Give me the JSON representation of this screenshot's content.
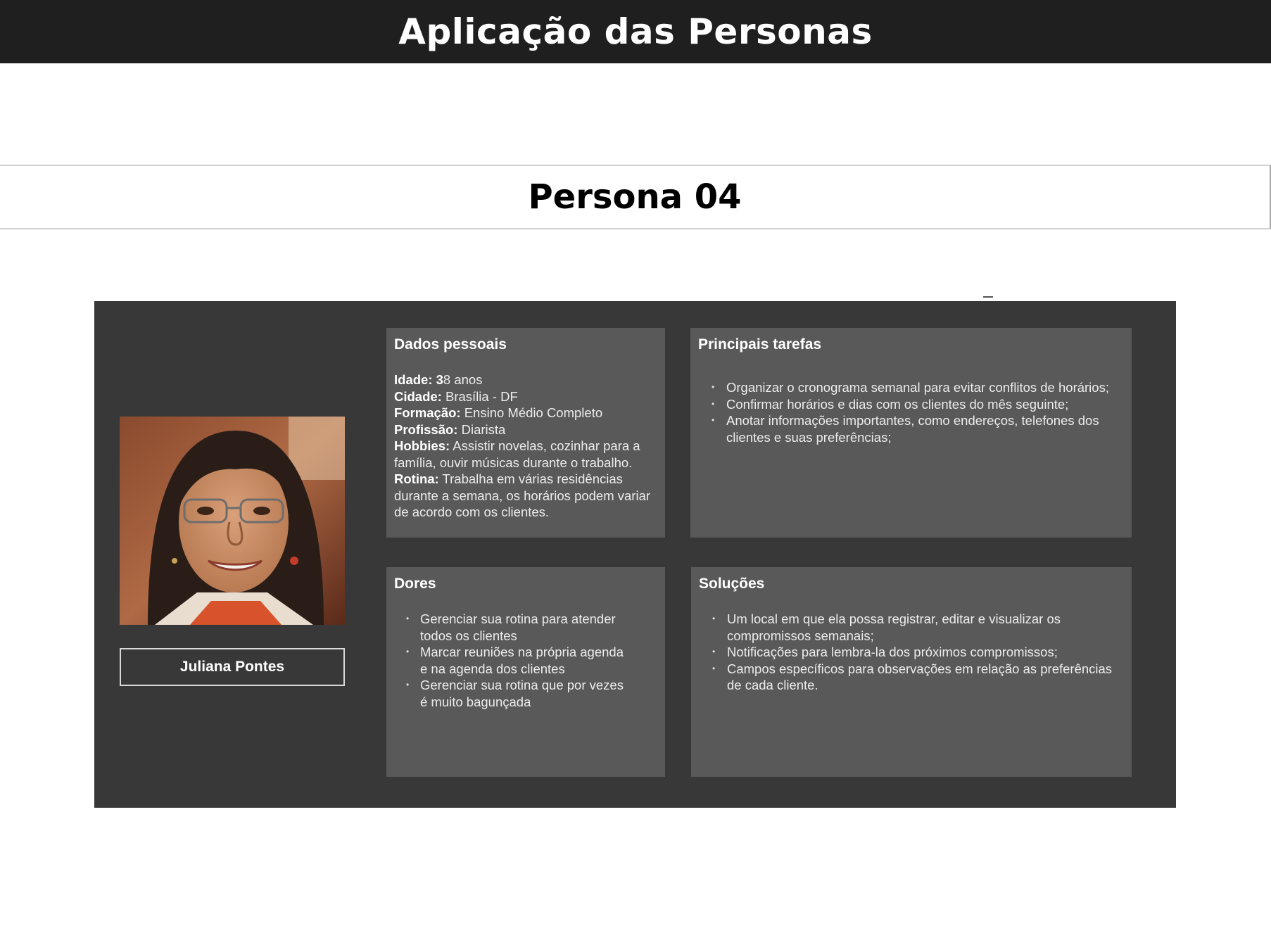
{
  "header": {
    "title": "Aplicação das Personas"
  },
  "persona": {
    "heading": "Persona 04",
    "name": "Juliana Pontes",
    "dados": {
      "title": "Dados pessoais",
      "fields": [
        {
          "label": "Idade:",
          "prefix": " 3",
          "value": "8 anos"
        },
        {
          "label": "Cidade:",
          "value": " Brasília - DF"
        },
        {
          "label": "Formação:",
          "value": " Ensino Médio Completo"
        },
        {
          "label": "Profissão:",
          "value": " Diarista"
        },
        {
          "label": "Hobbies:",
          "value": " Assistir novelas, cozinhar para a família, ouvir músicas durante o trabalho."
        },
        {
          "label": "Rotina:",
          "value": " Trabalha em várias residências durante a semana, os horários podem variar de acordo com os clientes."
        }
      ]
    },
    "tarefas": {
      "title": "Principais tarefas",
      "items": [
        "Organizar o cronograma semanal para evitar conflitos de horários;",
        "Confirmar horários e dias com os clientes do mês seguinte;",
        "Anotar informações importantes, como endereços, telefones dos clientes e suas preferências;"
      ]
    },
    "dores": {
      "title": "Dores",
      "items": [
        "Gerenciar sua rotina para atender todos os clientes",
        "Marcar reuniões na própria agenda e na agenda dos clientes",
        "Gerenciar sua rotina que por vezes é muito bagunçada"
      ]
    },
    "solucoes": {
      "title": "Soluções",
      "items": [
        "Um local em que ela possa registrar, editar e visualizar os compromissos semanais;",
        "Notificações para lembra-la dos próximos compromissos;",
        "Campos específicos para observações em relação as preferências de cada cliente."
      ]
    }
  },
  "colors": {
    "header_bg": "#1f1f1f",
    "card_bg": "#383838",
    "panel_bg": "#595959"
  },
  "icons": {
    "photo": "persona-portrait"
  }
}
